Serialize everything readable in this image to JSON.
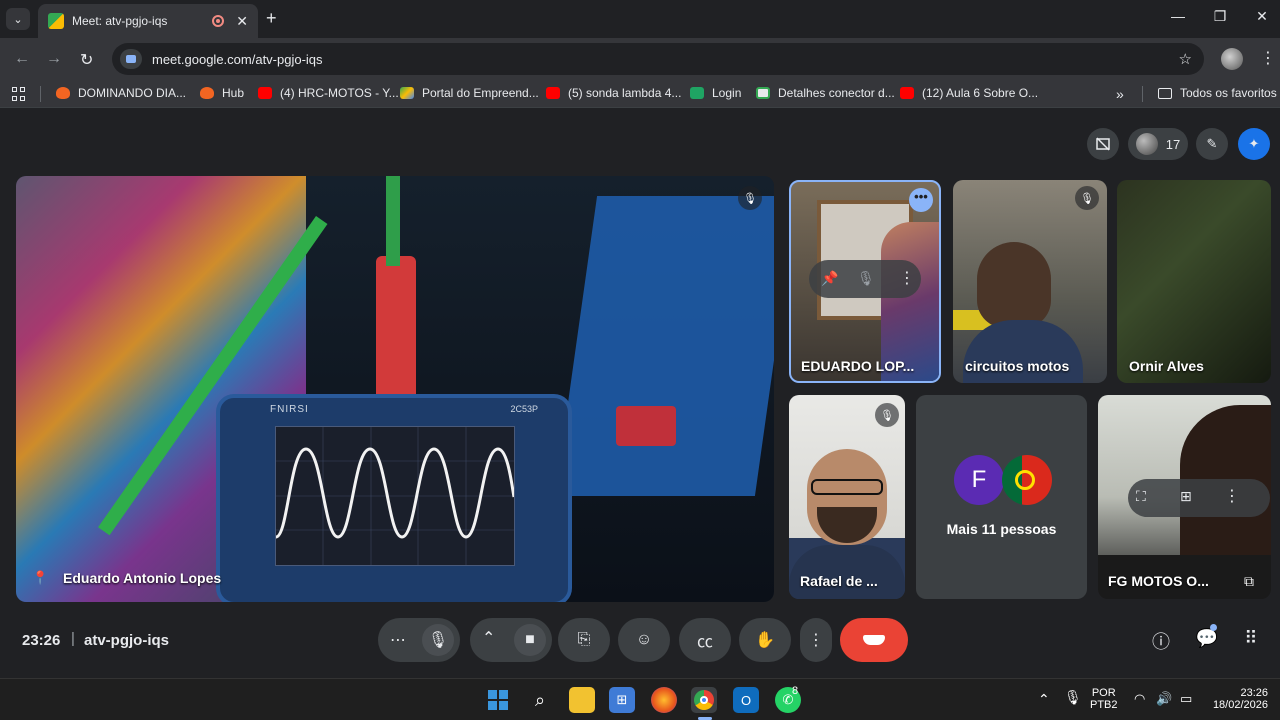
{
  "browser": {
    "tab_title": "Meet: atv-pgjo-iqs",
    "tab_close": "✕",
    "new_tab": "+",
    "tab_search": "⌄",
    "url": "meet.google.com/atv-pgjo-iqs",
    "window_minimize": "—",
    "window_restore": "❐",
    "window_close": "✕"
  },
  "bookmarks": {
    "items": [
      {
        "label": "DOMINANDO DIA...",
        "icon": "fire-icon"
      },
      {
        "label": "Hub",
        "icon": "fire-icon"
      },
      {
        "label": "(4) HRC-MOTOS - Y...",
        "icon": "youtube-icon"
      },
      {
        "label": "Portal do Empreend...",
        "icon": "drive-icon"
      },
      {
        "label": "(5) sonda lambda 4...",
        "icon": "youtube-icon"
      },
      {
        "label": "Login",
        "icon": "login-icon"
      },
      {
        "label": "Detalhes conector d...",
        "icon": "doc-icon"
      },
      {
        "label": "(12) Aula 6 Sobre O...",
        "icon": "youtube-icon"
      }
    ],
    "overflow": "»",
    "all_bookmarks": "Todos os favoritos"
  },
  "meet": {
    "participants_count": "17",
    "main_speaker": "Eduardo Antonio Lopes",
    "tiles": [
      {
        "name": "EDUARDO LOP...",
        "muted": false
      },
      {
        "name": "circuitos motos",
        "muted": true
      },
      {
        "name": "Ornir Alves",
        "muted": false
      },
      {
        "name": "Rafael de ...",
        "muted": true
      },
      {
        "name": "FG MOTOS O...",
        "muted": false
      }
    ],
    "more_people": {
      "label": "Mais 11 pessoas",
      "avatar_letter": "F"
    },
    "oscilloscope_brand": "FNIRSI",
    "oscilloscope_model": "2C53P",
    "clock": "23:26",
    "separator": "|",
    "meeting_code": "atv-pgjo-iqs"
  },
  "taskbar": {
    "lang_top": "POR",
    "lang_bottom": "PTB2",
    "time": "23:26",
    "date": "18/02/2026",
    "whatsapp_badge": "8"
  },
  "colors": {
    "end_call": "#ea4335",
    "accent": "#8ab4f8",
    "gemini": "#1a73e8"
  }
}
